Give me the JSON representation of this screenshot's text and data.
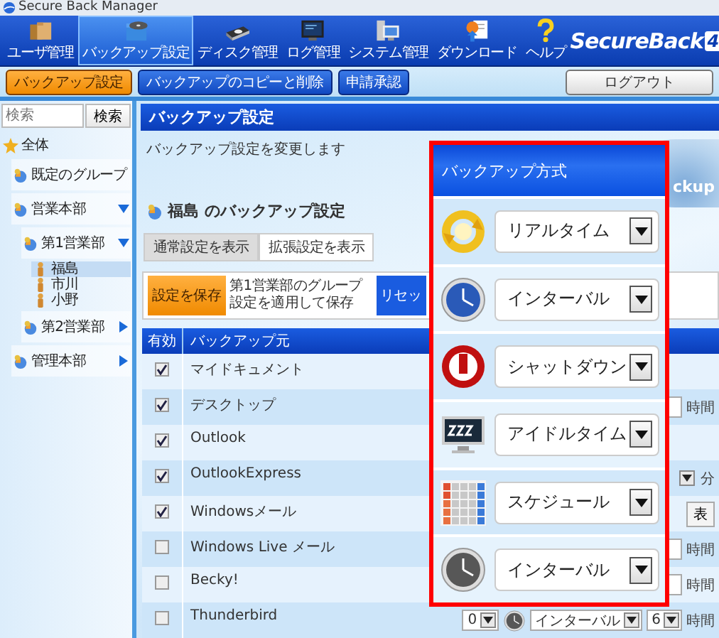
{
  "window": {
    "title": "Secure Back Manager"
  },
  "toolbar": [
    {
      "label": "ユーザ管理",
      "selected": false
    },
    {
      "label": "バックアップ設定",
      "selected": true
    },
    {
      "label": "ディスク管理",
      "selected": false
    },
    {
      "label": "ログ管理",
      "selected": false
    },
    {
      "label": "システム管理",
      "selected": false
    },
    {
      "label": "ダウンロード",
      "selected": false
    },
    {
      "label": "ヘルプ",
      "selected": false
    }
  ],
  "logo": {
    "text": "SecureBack",
    "badge": "4"
  },
  "subnav": [
    {
      "label": "バックアップ設定",
      "selected": true
    },
    {
      "label": "バックアップのコピーと削除",
      "selected": false
    },
    {
      "label": "申請承認",
      "selected": false
    }
  ],
  "logout": "ログアウト",
  "sidebar": {
    "search": {
      "placeholder": "検索",
      "button": "検索"
    },
    "tree": [
      {
        "label": "全体",
        "kind": "root",
        "selected": false,
        "children": [
          {
            "label": "既定のグループ",
            "kind": "group",
            "selected": false
          },
          {
            "label": "営業本部",
            "kind": "group",
            "selected": false,
            "expanded": true,
            "children": [
              {
                "label": "第1営業部",
                "kind": "group",
                "selected": false,
                "expanded": true,
                "children": [
                  {
                    "label": "福島",
                    "kind": "user",
                    "selected": true
                  },
                  {
                    "label": "市川",
                    "kind": "user",
                    "selected": false
                  },
                  {
                    "label": "小野",
                    "kind": "user",
                    "selected": false
                  }
                ]
              },
              {
                "label": "第2営業部",
                "kind": "group",
                "selected": false,
                "expanded": false
              }
            ]
          },
          {
            "label": "管理本部",
            "kind": "group",
            "selected": false,
            "expanded": false
          }
        ]
      }
    ]
  },
  "main": {
    "title": "バックアップ設定",
    "description": "バックアップ設定を変更します",
    "logo_text": "ckup",
    "heading": {
      "name": "福島",
      "suffix": " のバックアップ設定"
    },
    "views": [
      {
        "label": "通常設定を表示",
        "selected": true
      },
      {
        "label": "拡張設定を表示",
        "selected": false
      }
    ],
    "actions": [
      {
        "label": "設定を保存",
        "kind": "primary"
      },
      {
        "label": "第1営業部のグループ設定を適用して保存",
        "kind": "plain"
      },
      {
        "label": "リセッ",
        "kind": "reset"
      }
    ],
    "table": {
      "columns": [
        "有効",
        "バックアップ元"
      ],
      "rows": [
        {
          "enabled": true,
          "source": "マイドキュメント",
          "controls": []
        },
        {
          "enabled": true,
          "source": "デスクトップ",
          "controls": [
            {
              "kind": "spin"
            },
            {
              "kind": "unit",
              "text": "時間"
            }
          ]
        },
        {
          "enabled": true,
          "source": "Outlook",
          "controls": []
        },
        {
          "enabled": true,
          "source": "OutlookExpress",
          "controls": [
            {
              "kind": "dropdown"
            },
            {
              "kind": "unit",
              "text": "分"
            }
          ]
        },
        {
          "enabled": true,
          "source": "Windowsメール",
          "controls": [
            {
              "kind": "button",
              "text": "表"
            }
          ]
        },
        {
          "enabled": false,
          "source": "Windows Live メール",
          "controls": [
            {
              "kind": "spin"
            },
            {
              "kind": "unit",
              "text": "時間"
            }
          ]
        },
        {
          "enabled": false,
          "source": "Becky!",
          "controls": [
            {
              "kind": "spin"
            },
            {
              "kind": "unit",
              "text": "時間"
            }
          ]
        },
        {
          "enabled": false,
          "source": "Thunderbird",
          "controls": [
            {
              "kind": "dropdown",
              "value": "0"
            },
            {
              "kind": "method",
              "disabled": true
            },
            {
              "kind": "dropdown",
              "value": "インターバル"
            },
            {
              "kind": "dropdown",
              "value": "6"
            },
            {
              "kind": "unit",
              "text": "時間"
            }
          ]
        }
      ]
    }
  },
  "popup": {
    "title": "バックアップ方式",
    "methods": [
      {
        "kind": "realtime",
        "value": "リアルタイム",
        "disabled": false
      },
      {
        "kind": "interval",
        "value": "インターバル",
        "disabled": false
      },
      {
        "kind": "shutdown",
        "value": "シャットダウン",
        "disabled": false
      },
      {
        "kind": "idle",
        "value": "アイドルタイム",
        "disabled": false
      },
      {
        "kind": "schedule",
        "value": "スケジュール",
        "disabled": false
      },
      {
        "kind": "interval",
        "value": "インターバル",
        "disabled": true
      }
    ]
  }
}
